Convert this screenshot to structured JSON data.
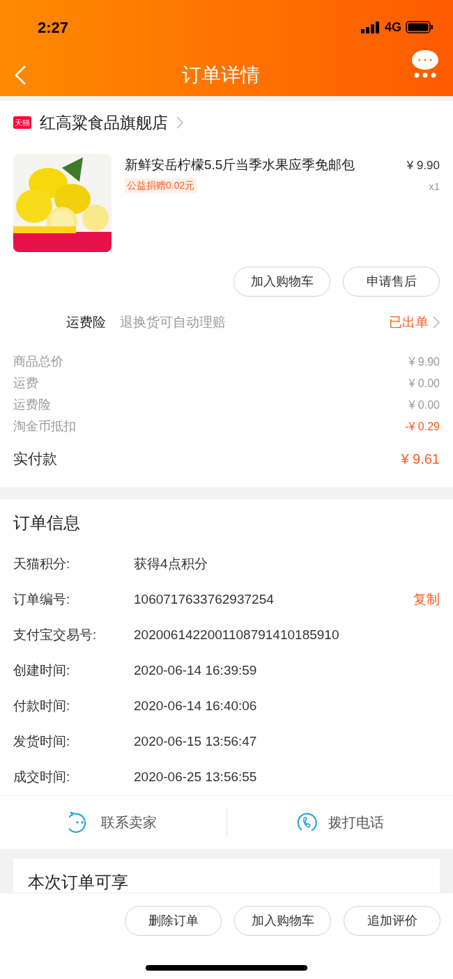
{
  "status_bar": {
    "time": "2:27",
    "network": "4G"
  },
  "header": {
    "title": "订单详情"
  },
  "store": {
    "badge": "天猫",
    "name": "红高粱食品旗舰店"
  },
  "product": {
    "kind": "picture",
    "title": "新鲜安岳柠檬5.5斤当季水果应季免邮包",
    "donation": "公益捐赠0.02元",
    "price": "¥ 9.90",
    "quantity": "x1",
    "buttons": [
      "加入购物车",
      "申请售后"
    ]
  },
  "insurance": {
    "label": "运费险",
    "description": "退换货可自动理赔",
    "status": "已出单"
  },
  "costs": [
    {
      "label": "商品总价",
      "value": "¥ 9.90",
      "highlight": false
    },
    {
      "label": "运费",
      "value": "¥ 0.00",
      "highlight": false
    },
    {
      "label": "运费险",
      "value": "¥ 0.00",
      "highlight": false
    },
    {
      "label": "淘金币抵扣",
      "value": "-¥ 0.29",
      "highlight": true
    }
  ],
  "paid": {
    "label": "实付款",
    "value": "¥ 9.61"
  },
  "order_info": {
    "title": "订单信息",
    "rows": [
      {
        "label": "天猫积分:",
        "value": "获得4点积分"
      },
      {
        "label": "订单编号:",
        "value": "1060717633762937254",
        "action": "复制"
      },
      {
        "label": "支付宝交易号:",
        "value": "2020061422001108791410185910"
      },
      {
        "label": "创建时间:",
        "value": "2020-06-14 16:39:59"
      },
      {
        "label": "付款时间:",
        "value": "2020-06-14 16:40:06"
      },
      {
        "label": "发货时间:",
        "value": "2020-06-15 13:56:47"
      },
      {
        "label": "成交时间:",
        "value": "2020-06-25 13:56:55"
      }
    ]
  },
  "contact": [
    {
      "kind": "chat",
      "label": "联系卖家"
    },
    {
      "kind": "phone",
      "label": "拨打电话"
    }
  ],
  "benefits": {
    "title": "本次订单可享"
  },
  "bottom_buttons": [
    "删除订单",
    "加入购物车",
    "追加评价"
  ]
}
